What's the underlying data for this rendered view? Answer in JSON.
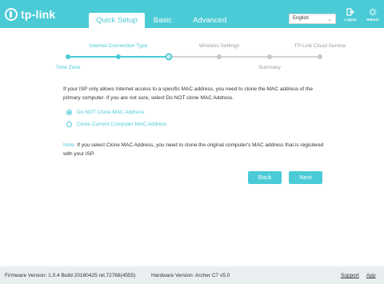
{
  "brand": {
    "name": "tp-link"
  },
  "nav": {
    "tabs": [
      "Quick Setup",
      "Basic",
      "Advanced"
    ],
    "active": "Quick Setup"
  },
  "language": {
    "selected": "English"
  },
  "header_actions": {
    "logout": "Logout",
    "reboot": "Reboot"
  },
  "steps": {
    "labels": [
      "Time Zone",
      "Internet Connection Type",
      "Wireless Settings",
      "Summary",
      "TP-Link Cloud Service"
    ],
    "completed": 2,
    "current": 3,
    "total": 6
  },
  "content": {
    "intro": "If your ISP only allows Internet access to a specific MAC address, you need to clone the MAC address of the primary computer. If you are not sure, select Do NOT clone MAC Address.",
    "options": [
      {
        "label": "Do NOT Clone MAC Address",
        "checked": true
      },
      {
        "label": "Clone Current Computer MAC Address",
        "checked": false
      }
    ],
    "note_label": "Note:",
    "note_text": "If you select Clone MAC Address, you need to clone the original computer's MAC address that is registered with your ISP."
  },
  "buttons": {
    "back": "Back",
    "next": "Next"
  },
  "footer": {
    "firmware": "Firmware Version: 1.0.4 Build 20180425 rel.72768(4555)",
    "hardware": "Hardware Version: Archer C7 v5.0",
    "support": "Support",
    "app": "App"
  },
  "colors": {
    "accent": "#4acbd6",
    "inactive": "#c7c7c7"
  },
  "icons": {
    "logout": "logout-icon",
    "reboot": "reboot-icon",
    "logo": "tplink-logo-icon"
  }
}
